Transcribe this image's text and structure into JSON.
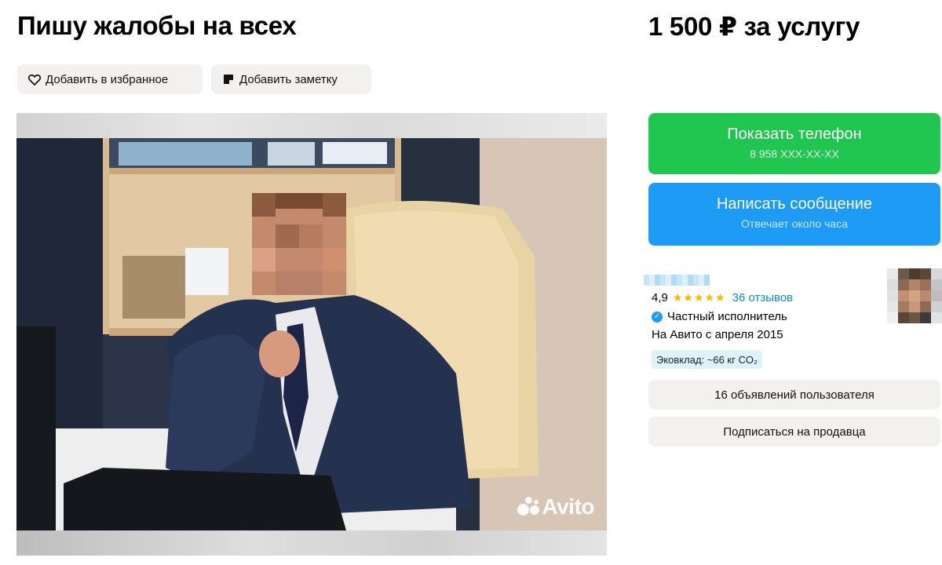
{
  "listing": {
    "title": "Пишу жалобы на всех",
    "price": "1 500 ₽ за услугу"
  },
  "actions": {
    "favorite_label": "Добавить в избранное",
    "note_label": "Добавить заметку"
  },
  "photo": {
    "watermark": "Avito"
  },
  "contact": {
    "phone_label": "Показать телефон",
    "phone_masked": "8 958 XXX-XX-XX",
    "message_label": "Написать сообщение",
    "message_sub": "Отвечает около часа"
  },
  "seller": {
    "rating": "4,9",
    "stars": "★★★★★",
    "reviews": "36 отзывов",
    "type": "Частный исполнитель",
    "since": "На Авито с апреля 2015",
    "eco": "Эковклад: ~66 кг CO₂",
    "listings_button": "16 объявлений пользователя",
    "subscribe_button": "Подписаться на продавца"
  },
  "colors": {
    "phone_button": "#20c650",
    "message_button": "#1e9bf5",
    "stars": "#ffb400",
    "link": "#0a8ad6",
    "chip_bg": "#f2f1f0"
  },
  "icons": [
    "heart-outline-icon",
    "note-icon",
    "verified-check-icon",
    "avito-logo-icon"
  ]
}
